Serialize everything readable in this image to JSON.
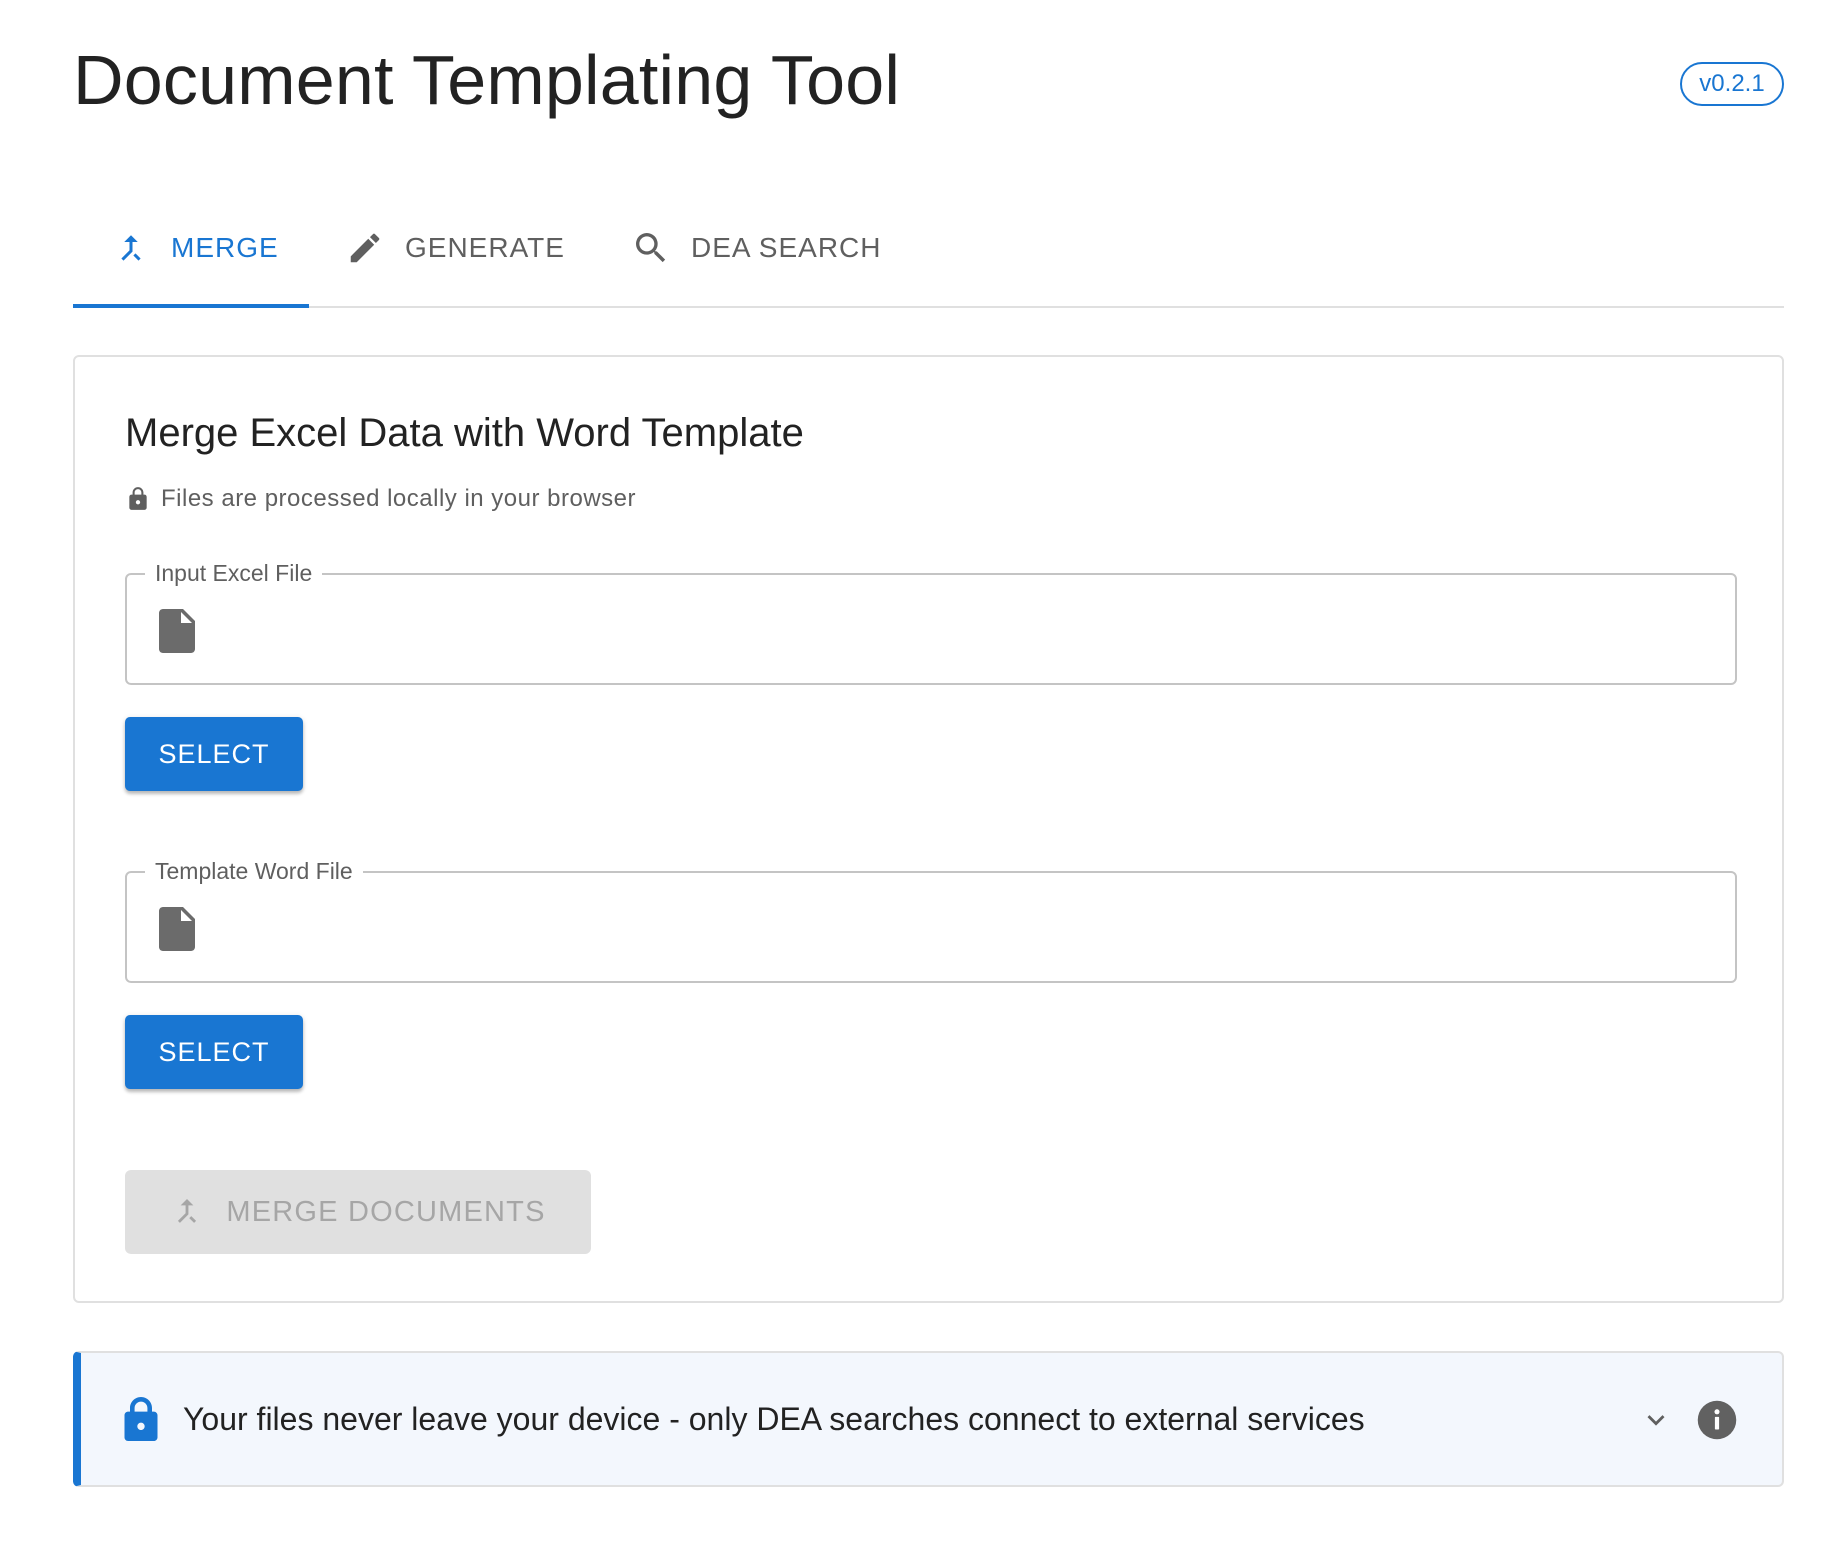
{
  "app": {
    "title": "Document Templating Tool",
    "version": "v0.2.1"
  },
  "tabs": [
    {
      "label": "MERGE",
      "icon": "merge-icon",
      "active": true
    },
    {
      "label": "GENERATE",
      "icon": "pencil-icon",
      "active": false
    },
    {
      "label": "DEA SEARCH",
      "icon": "search-icon",
      "active": false
    }
  ],
  "merge_card": {
    "title": "Merge Excel Data with Word Template",
    "privacy_note": "Files are processed locally in your browser",
    "excel_field": {
      "label": "Input Excel File",
      "value": "",
      "button_label": "SELECT"
    },
    "word_field": {
      "label": "Template Word File",
      "value": "",
      "button_label": "SELECT"
    },
    "merge_button_label": "MERGE DOCUMENTS",
    "merge_button_disabled": true
  },
  "info_banner": {
    "text": "Your files never leave your device - only DEA searches connect to external services",
    "lock_icon": "lock-icon",
    "expand_icon": "chevron-down-icon",
    "info_icon": "info-icon"
  },
  "colors": {
    "accent": "#1976d2",
    "muted_text": "#5f5f5f",
    "disabled_bg": "#e0e0e0",
    "banner_bg": "#f3f7fd"
  }
}
